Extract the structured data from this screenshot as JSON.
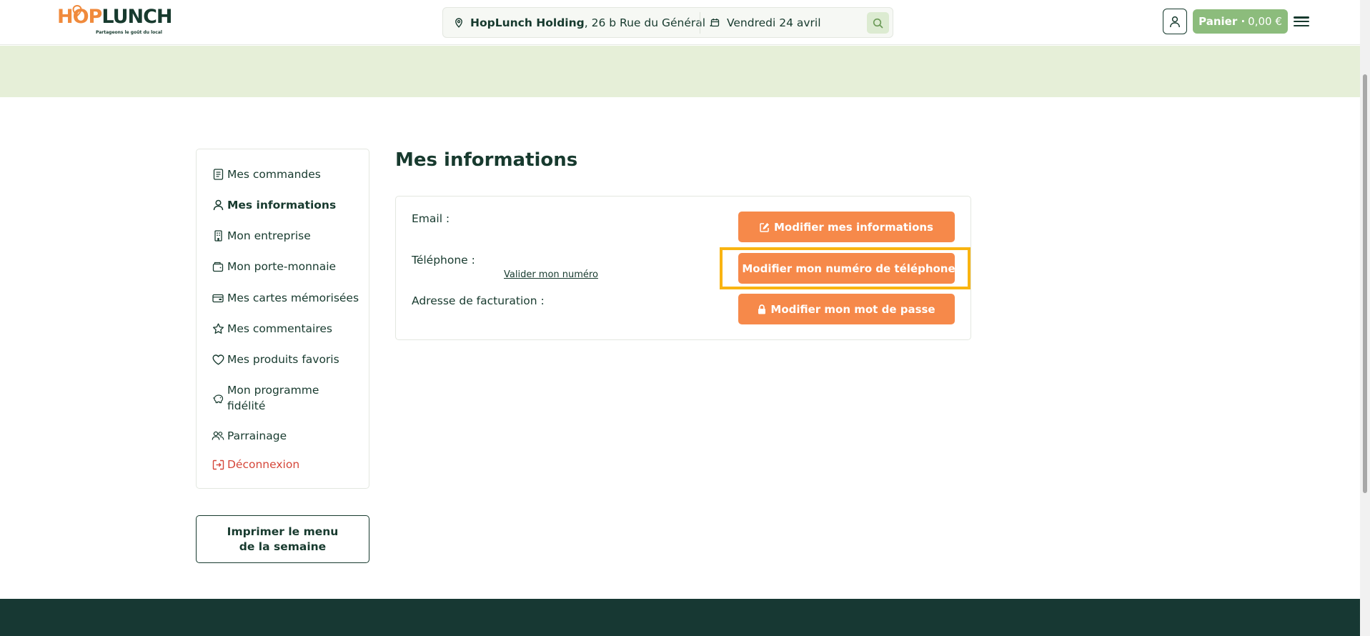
{
  "brand": {
    "hop": "HOP",
    "lunch": "LUNCH",
    "tagline": "Partageons le goût du local"
  },
  "search": {
    "company": "HopLunch Holding",
    "address": ", 26 b Rue du Général ...",
    "date": "Vendredi 24 avril",
    "icons": {
      "location": "map-pin-icon",
      "date": "calendar-icon",
      "search": "search-icon"
    }
  },
  "header": {
    "cart_label": "Panier ·",
    "cart_amount": "0,00 €",
    "icons": {
      "user": "user-icon",
      "menu": "hamburger-menu-icon"
    }
  },
  "sidebar": {
    "items": [
      {
        "label": "Mes commandes",
        "icon": "receipt-icon"
      },
      {
        "label": "Mes informations",
        "icon": "user-icon",
        "active": true
      },
      {
        "label": "Mon entreprise",
        "icon": "building-icon"
      },
      {
        "label": "Mon porte-monnaie",
        "icon": "wallet-icon"
      },
      {
        "label": "Mes cartes mémorisées",
        "icon": "credit-card-icon"
      },
      {
        "label": "Mes commentaires",
        "icon": "star-icon"
      },
      {
        "label": "Mes produits favoris",
        "icon": "heart-icon"
      },
      {
        "label": "Mon programme fidélité",
        "icon": "piggy-bank-icon"
      },
      {
        "label": "Parrainage",
        "icon": "users-icon"
      },
      {
        "label": "Déconnexion",
        "icon": "logout-icon",
        "danger": true
      }
    ],
    "print_label": "Imprimer le menu de la semaine"
  },
  "main": {
    "title": "Mes informations",
    "fields": {
      "email": "Email :",
      "phone": "Téléphone :",
      "billing": "Adresse de facturation :"
    },
    "validate_phone": "Valider mon numéro",
    "buttons": {
      "edit_info": "Modifier mes informations",
      "edit_phone": "Modifier mon numéro de téléphone",
      "edit_password": "Modifier mon mot de passe"
    }
  },
  "colors": {
    "primary_dark": "#173a2e",
    "accent_orange": "#f6894a",
    "cart_green": "#8cbc7c",
    "banner_green": "#e6efd8",
    "danger": "#d5473a",
    "highlight": "#f9b411",
    "footer": "#173833"
  }
}
